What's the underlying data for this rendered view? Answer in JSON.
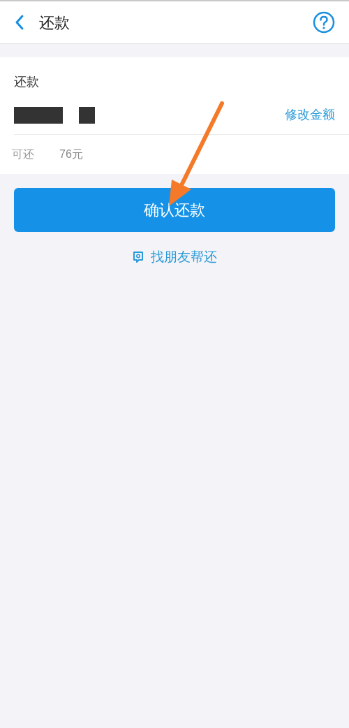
{
  "header": {
    "title": "还款"
  },
  "card": {
    "label": "还款",
    "edit_link": "修改金额",
    "available_prefix": "可还",
    "available_suffix": "76元"
  },
  "confirm_button": "确认还款",
  "friend_link": "找朋友帮还"
}
